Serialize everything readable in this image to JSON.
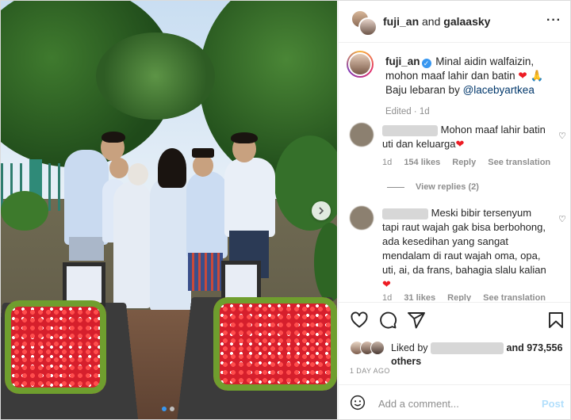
{
  "header": {
    "user1": "fuji_an",
    "joiner": "and",
    "user2": "galaasky",
    "more_icon": "more-horizontal-icon"
  },
  "caption": {
    "username": "fuji_an",
    "line1": "Minal aidin walfaizin,",
    "line2": "mohon maaf lahir dan batin",
    "emoji_heart": "❤️",
    "emoji_pray": "🙏",
    "line3_prefix": "Baju lebaran by ",
    "mention": "@lacebyartkea",
    "meta": "Edited · 1d"
  },
  "comments": [
    {
      "text_line1": "Mohon maaf lahir batin",
      "text_line2": "uti dan keluarga",
      "emoji": "❤️",
      "age": "1d",
      "likes": "154 likes",
      "reply": "Reply",
      "translate": "See translation",
      "view_replies": "View replies (2)"
    },
    {
      "text_line1": "Meski bibir tersenyum",
      "text_rest": "tapi raut wajah gak bisa berbohong, ada kesedihan yang sangat mendalam di raut wajah oma, opa, uti, ai, da frans, bahagia slalu kalian",
      "emoji": "❤️",
      "age": "1d",
      "likes": "31 likes",
      "reply": "Reply",
      "translate": "See translation"
    }
  ],
  "likes": {
    "prefix": "Liked by",
    "and_text": "and 973,556",
    "others": "others"
  },
  "date": "1 DAY AGO",
  "add_comment": {
    "placeholder": "Add a comment...",
    "post": "Post"
  },
  "colors": {
    "link": "#00376b",
    "post": "#b2dffc",
    "verified": "#3897f0",
    "heart": "#ed1c24"
  }
}
